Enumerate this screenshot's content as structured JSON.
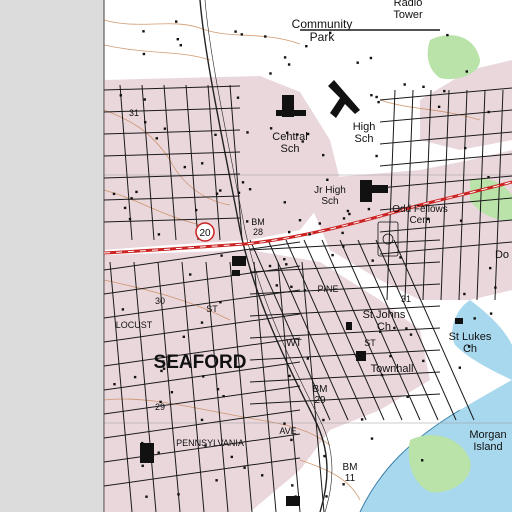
{
  "map": {
    "colors": {
      "paper": "#ffffff",
      "margin": "#dcdcdc",
      "urban_tint": "#d9b7c0",
      "contour": "#c98a5a",
      "water": "#a8d8ee",
      "vegetation": "#b9e3a8",
      "road": "#1a1a1a",
      "highway": "#cc2222",
      "grid_line": "#999999"
    },
    "labels": {
      "radio_tower": "Radio\nTower",
      "community_park": "Community\nPark",
      "central_sch": "Central\nSch",
      "high_sch": "High\nSch",
      "jr_high_sch": "Jr High\nSch",
      "odd_fellows_cem": "Odd Fellows\nCem",
      "bm_top": "BM\n28",
      "route_20": "20",
      "do_label": "Do",
      "elev_30": "30",
      "locust_st": "LOCUST",
      "st_label_1": "ST",
      "pine_st": "PINE",
      "st_label_2": "ST",
      "elev_31": "31",
      "st_johns_ch": "St Johns\nCh",
      "st_lukes_ch": "St Lukes\nCh",
      "wt": "WT",
      "seaford": "SEAFORD",
      "townhall": "Townhall",
      "elev_29": "29",
      "bm_29": "BM\n29",
      "pennsylvania_ave": "PENNSYLVANIA",
      "ave": "AVE",
      "morgan_island": "Morgan\nIsland",
      "bm_bottom": "BM\n11",
      "elev_31_top": "31"
    }
  }
}
